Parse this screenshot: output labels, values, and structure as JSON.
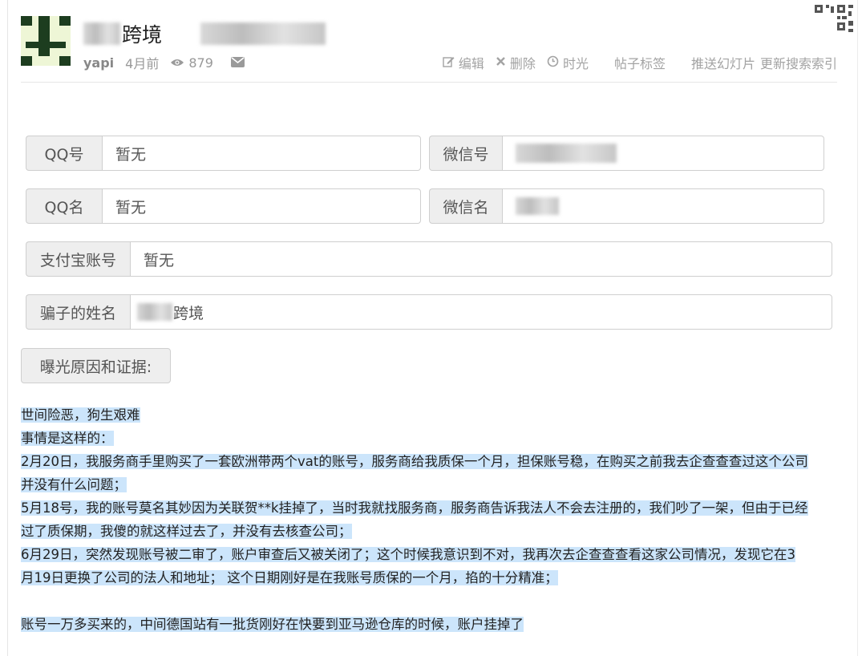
{
  "header": {
    "title_suffix": "跨境",
    "author": "yapi",
    "time": "4月前",
    "views": "879"
  },
  "actions": {
    "edit": "编辑",
    "delete": "删除",
    "timeline": "时光",
    "tags": "帖子标签",
    "push": "推送幻灯片",
    "reindex": "更新搜索索引"
  },
  "form": {
    "qq_number": {
      "label": "QQ号",
      "value": "暂无"
    },
    "wechat_number": {
      "label": "微信号",
      "value": ""
    },
    "qq_name": {
      "label": "QQ名",
      "value": "暂无"
    },
    "wechat_name": {
      "label": "微信名",
      "value": ""
    },
    "alipay": {
      "label": "支付宝账号",
      "value": "暂无"
    },
    "scammer_name": {
      "label": "骗子的姓名",
      "value": "跨境"
    },
    "evidence_label": "曝光原因和证据:"
  },
  "post": {
    "lines": [
      "世间险恶，狗生艰难",
      "事情是这样的：",
      "2月20日，我服务商手里购买了一套欧洲带两个vat的账号，服务商给我质保一个月，担保账号稳，在购买之前我去企查查查过这个公司",
      "并没有什么问题；",
      "5月18号，我的账号莫名其妙因为关联贺**k挂掉了，当时我就找服务商，服务商告诉我法人不会去注册的，我们吵了一架，但由于已经",
      "过了质保期，我傻的就这样过去了，并没有去核查公司；",
      "6月29日，突然发现账号被二审了，账户审查后又被关闭了；这个时候我意识到不对，我再次去企查查查看这家公司情况，发现它在3",
      "月19日更换了公司的法人和地址；   这个日期刚好是在我账号质保的一个月，掐的十分精准；",
      "账号一万多买来的，中间德国站有一批货刚好在快要到亚马逊仓库的时候，账户挂掉了"
    ]
  },
  "colors": {
    "highlight": "#cce5fb",
    "addon_bg": "#eeeeee",
    "meta_gray": "#999999"
  }
}
